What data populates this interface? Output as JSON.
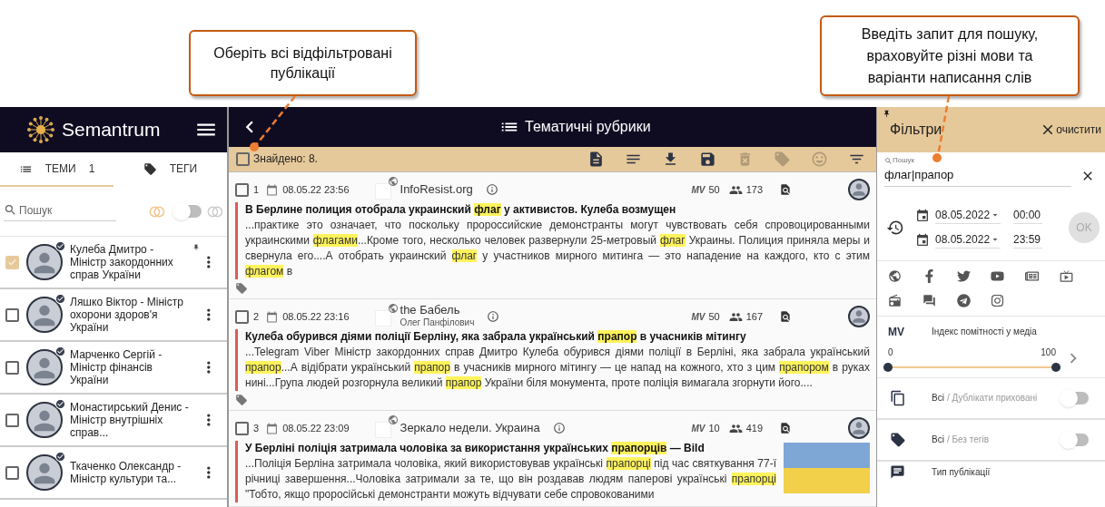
{
  "callouts": [
    {
      "text": "Оберіть всі відфільтровані публікації"
    },
    {
      "text": "Введіть запит для пошуку, враховуйте різні мови та варіанти написання слів"
    }
  ],
  "header": {
    "logo": "Semantrum",
    "title": "Тематичні рубрики"
  },
  "sidebar": {
    "tabs": [
      {
        "label": "ТЕМИ",
        "count": "1",
        "selected": true
      },
      {
        "label": "ТЕГИ",
        "selected": false
      }
    ],
    "search": {
      "placeholder": "Пошук"
    },
    "toggle_on": false,
    "items": [
      {
        "name": "Кулеба Дмитро - Міністр закордонних справ України",
        "checked": true,
        "pinned": true
      },
      {
        "name": "Ляшко Віктор - Міністр охорони здоров'я України",
        "checked": false,
        "pinned": false
      },
      {
        "name": "Марченко Сергій - Міністр фінансів України",
        "checked": false,
        "pinned": false
      },
      {
        "name": "Монастирський Денис - Міністр внутрішніх справ...",
        "checked": false,
        "pinned": false
      },
      {
        "name": "Ткаченко Олександр - Міністр культури та...",
        "checked": false,
        "pinned": false
      }
    ]
  },
  "results": {
    "found": "Знайдено: 8.",
    "select_all_checked": false,
    "toolbar": [
      {
        "kind": "document",
        "disabled": false
      },
      {
        "kind": "text",
        "disabled": false
      },
      {
        "kind": "download",
        "disabled": false
      },
      {
        "kind": "save",
        "disabled": false
      },
      {
        "kind": "delete",
        "disabled": true
      },
      {
        "kind": "tag",
        "disabled": true
      },
      {
        "kind": "mood",
        "disabled": true
      },
      {
        "kind": "filter",
        "disabled": false
      }
    ],
    "articles": [
      {
        "index": "1",
        "date": "08.05.22 23:56",
        "source": "InfoResist.org",
        "mv_label": "MV",
        "mv": "50",
        "reach": "173",
        "checked": false,
        "tags": true,
        "thumbnail": false,
        "title": [
          {
            "text": "В Берлине полиция отобрала украинский ",
            "highlight": false
          },
          {
            "text": "флаг",
            "highlight": true
          },
          {
            "text": " у активистов. Кулеба возмущен",
            "highlight": false
          }
        ],
        "snippet": [
          {
            "text": "...практике это означает, что поскольку пророссийские демонстранты могут чувствовать себя спровоцированными украинскими ",
            "highlight": false
          },
          {
            "text": "флагами",
            "highlight": true
          },
          {
            "text": "...Кроме того, несколько человек развернули 25-метровый ",
            "highlight": false
          },
          {
            "text": "флаг",
            "highlight": true
          },
          {
            "text": " Украины. Полиция приняла меры и свернула его....А отобрать украинский ",
            "highlight": false
          },
          {
            "text": "флаг",
            "highlight": true
          },
          {
            "text": " у участников мирного митинга — это нападение на каждого, кто с этим ",
            "highlight": false
          },
          {
            "text": "флагом",
            "highlight": true
          },
          {
            "text": " в",
            "highlight": false
          }
        ]
      },
      {
        "index": "2",
        "date": "08.05.22 23:16",
        "source": "the Бабель",
        "author": "Олег Панфілович",
        "mv_label": "MV",
        "mv": "50",
        "reach": "167",
        "checked": false,
        "tags": true,
        "thumbnail": false,
        "title": [
          {
            "text": "Кулеба обурився діями поліції Берліну, яка забрала український ",
            "highlight": false
          },
          {
            "text": "прапор",
            "highlight": true
          },
          {
            "text": " в учасників мітингу",
            "highlight": false
          }
        ],
        "snippet": [
          {
            "text": "...Telegram Viber Міністр закордонних справ Дмитро Кулеба обурився діями поліції в Берліні, яка забрала український ",
            "highlight": false
          },
          {
            "text": "прапор",
            "highlight": true
          },
          {
            "text": "...А відібрати український ",
            "highlight": false
          },
          {
            "text": "прапор",
            "highlight": true
          },
          {
            "text": " в учасників мирного мітингу — це напад на кожного, хто з цим ",
            "highlight": false
          },
          {
            "text": "прапором",
            "highlight": true
          },
          {
            "text": " в руках нині...Група людей розгорнула великий ",
            "highlight": false
          },
          {
            "text": "прапор",
            "highlight": true
          },
          {
            "text": " України біля монумента, проте поліція вимагала згорнути його....",
            "highlight": false
          }
        ]
      },
      {
        "index": "3",
        "date": "08.05.22 23:09",
        "source": "Зеркало недели. Украина",
        "mv_label": "MV",
        "mv": "10",
        "reach": "419",
        "checked": false,
        "tags": false,
        "thumbnail": true,
        "title": [
          {
            "text": "У Берліні поліція затримала чоловіка за використання українських ",
            "highlight": false
          },
          {
            "text": "прапорців",
            "highlight": true
          },
          {
            "text": " — Bild",
            "highlight": false
          }
        ],
        "snippet": [
          {
            "text": "...Поліція Берліна затримала чоловіка, який використовував українські ",
            "highlight": false
          },
          {
            "text": "прапорці",
            "highlight": true
          },
          {
            "text": " під час святкування 77-ї річниці завершення...Чоловіка затримали за те, що він роздавав людям паперові українські ",
            "highlight": false
          },
          {
            "text": "прапорці",
            "highlight": true
          },
          {
            "text": " \"Тобто, якщо проросійські демонстранти можуть відчувати себе спровокованими",
            "highlight": false
          }
        ]
      }
    ]
  },
  "filters": {
    "title": "Фільтри",
    "clear": "очистити",
    "search": {
      "label": "Пошук",
      "value": "флаг|прапор"
    },
    "period": {
      "from": {
        "date": "08.05.2022",
        "time": "00:00"
      },
      "to": {
        "date": "08.05.2022",
        "time": "23:59"
      },
      "ok": "OK"
    },
    "sources": [
      {
        "kind": "web"
      },
      {
        "kind": "facebook"
      },
      {
        "kind": "twitter"
      },
      {
        "kind": "youtube"
      },
      {
        "kind": "press"
      },
      {
        "kind": "tv"
      },
      {
        "kind": "radio"
      },
      {
        "kind": "forum"
      },
      {
        "kind": "telegram"
      },
      {
        "kind": "instagram"
      }
    ],
    "media_index": {
      "badge": "MV",
      "label": "Індекс помітності у медіа",
      "min": "0",
      "max": "100",
      "thumbs": [
        {
          "level": 0
        },
        {
          "level": 1
        }
      ]
    },
    "switches": [
      {
        "kind": "duplicates",
        "label": "Всі",
        "hint": "/ Дублікати приховані",
        "on": false
      },
      {
        "kind": "tags",
        "label": "Всі",
        "hint": "/ Без тегів",
        "on": false
      }
    ],
    "publication_type": "Тип публікації"
  }
}
